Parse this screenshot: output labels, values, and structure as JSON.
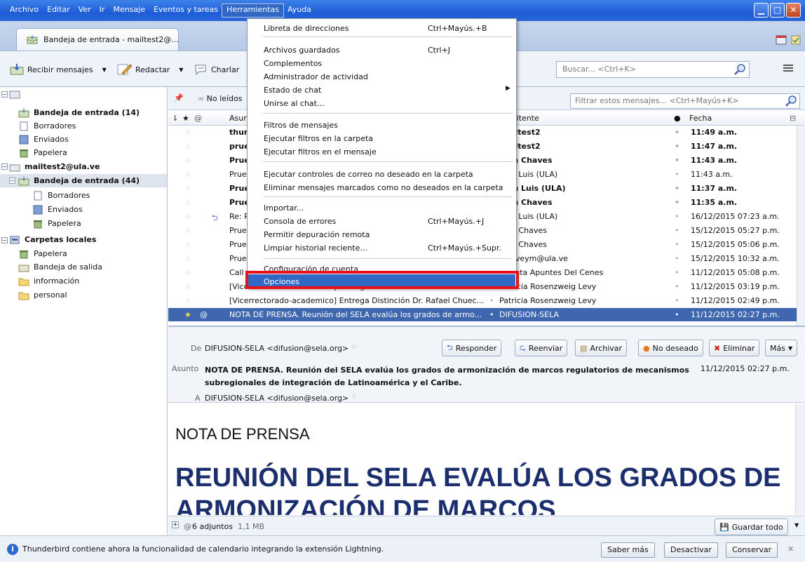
{
  "menubar": {
    "items": [
      "Archivo",
      "Editar",
      "Ver",
      "Ir",
      "Mensaje",
      "Eventos y tareas",
      "Herramientas",
      "Ayuda"
    ]
  },
  "tab": {
    "label": "Bandeja de entrada - mailtest2@..."
  },
  "toolbar": {
    "get_mail": "Recibir mensajes",
    "write": "Redactar",
    "chat": "Charlar",
    "search_placeholder": "Buscar... <Ctrl+K>"
  },
  "folders": [
    {
      "label": "Bandeja de entrada (14)",
      "bold": true,
      "icon": "inbox-icon"
    },
    {
      "label": "Borradores",
      "icon": "drafts-icon"
    },
    {
      "label": "Enviados",
      "icon": "sent-icon"
    },
    {
      "label": "Papelera",
      "icon": "trash-icon"
    },
    {
      "label": "mailtest2@ula.ve",
      "bold": true,
      "icon": "account-icon"
    },
    {
      "label": "Bandeja de entrada (44)",
      "bold": true,
      "icon": "inbox-icon"
    },
    {
      "label": "Borradores",
      "icon": "drafts-icon"
    },
    {
      "label": "Enviados",
      "icon": "sent-icon"
    },
    {
      "label": "Papelera",
      "icon": "trash-icon"
    },
    {
      "label": "Carpetas locales",
      "bold": true,
      "icon": "local-folders-icon"
    },
    {
      "label": "Papelera",
      "icon": "trash-icon"
    },
    {
      "label": "Bandeja de salida",
      "icon": "outbox-icon"
    },
    {
      "label": "información",
      "icon": "folder-icon"
    },
    {
      "label": "personal",
      "icon": "folder-icon"
    }
  ],
  "quickfilter": {
    "unread": "No leídos",
    "filter_placeholder": "Filtrar estos mensajes... <Ctrl+Mayús+K>"
  },
  "columns": {
    "subject": "Asunto",
    "sender": "Remitente",
    "date": "Fecha"
  },
  "messages": [
    {
      "subject": "thunderbird",
      "sender": "mailtest2",
      "date": "11:49 a.m.",
      "bold": true
    },
    {
      "subject": "prueba",
      "sender": "mailtest2",
      "date": "11:47 a.m.",
      "bold": true
    },
    {
      "subject": "Prueba",
      "sender": "Juan Chaves",
      "date": "11:43 a.m.",
      "bold": true
    },
    {
      "subject": "Prueba",
      "sender": "Juan Luis (ULA)",
      "date": "11:43 a.m.",
      "bold": false
    },
    {
      "subject": "Prueba",
      "sender": "Juan Luis (ULA)",
      "date": "11:37 a.m.",
      "bold": true
    },
    {
      "subject": "Prueba",
      "sender": "Juan Chaves",
      "date": "11:35 a.m.",
      "bold": true
    },
    {
      "subject": "Re: Prueba",
      "sender": "Juan Luis (ULA)",
      "date": "16/12/2015 07:23 a.m.",
      "bold": false
    },
    {
      "subject": "Prueba",
      "sender": "Juan Chaves",
      "date": "15/12/2015 05:27 p.m.",
      "bold": false
    },
    {
      "subject": "Prueba",
      "sender": "Juan Chaves",
      "date": "15/12/2015 05:06 p.m.",
      "bold": false
    },
    {
      "subject": "Prueba",
      "sender": "jchaveym@ula.ve",
      "date": "15/12/2015 10:32 a.m.",
      "bold": false
    },
    {
      "subject": "Call for papers",
      "sender": "Revista Apuntes Del Cenes",
      "date": "11/12/2015 05:08 p.m.",
      "bold": false
    },
    {
      "subject": "[Vicerrectorado-academico] Entrega Distinción Dr. Rafael Chuec...",
      "sender": "Patricia Rosenzweig Levy",
      "date": "11/12/2015 03:19 p.m.",
      "bold": false
    },
    {
      "subject": "[Vicerrectorado-academico] Entrega Distinción Dr. Rafael Chuec...",
      "sender": "Patricia Rosenzweig Levy",
      "date": "11/12/2015 02:49 p.m.",
      "bold": false
    },
    {
      "subject": "NOTA DE PRENSA. Reunión del SELA evalúa los grados de armo...",
      "sender": "DIFUSION-SELA",
      "date": "11/12/2015 02:27 p.m.",
      "bold": false
    }
  ],
  "preview": {
    "from_label": "De",
    "from": "DIFUSION-SELA <difusion@sela.org>",
    "subject_label": "Asunto",
    "subject": "NOTA DE PRENSA. Reunión del SELA evalúa los grados de armonización de marcos regulatorios de mecanismos subregionales de integración de Latinoamérica y el Caribe.",
    "date": "11/12/2015 02:27 p.m.",
    "to_label": "A",
    "to": "DIFUSION-SELA <difusion@sela.org>",
    "buttons": {
      "reply": "Responder",
      "forward": "Reenviar",
      "archive": "Archivar",
      "junk": "No deseado",
      "delete": "Eliminar",
      "more": "Más"
    },
    "heading": "NOTA DE PRENSA",
    "headline": "REUNIÓN DEL SELA EVALÚA LOS GRADOS DE ARMONIZACIÓN DE MARCOS",
    "attachments": "6 adjuntos",
    "attachments_size": "1,1 MB",
    "save_all": "Guardar todo"
  },
  "notification": {
    "text": "Thunderbird contiene ahora la funcionalidad de calendario integrando la extensión Lightning.",
    "learn_more": "Saber más",
    "disable": "Desactivar",
    "keep": "Conservar"
  },
  "tools_menu": [
    {
      "label": "Libreta de direcciones",
      "shortcut": "Ctrl+Mayús.+B"
    },
    {
      "label": "Archivos guardados",
      "shortcut": "Ctrl+J"
    },
    {
      "label": "Complementos",
      "shortcut": ""
    },
    {
      "label": "Administrador de actividad",
      "shortcut": ""
    },
    {
      "label": "Estado de chat",
      "shortcut": ""
    },
    {
      "label": "Unirse al chat...",
      "shortcut": ""
    },
    {
      "label": "Filtros de mensajes",
      "shortcut": ""
    },
    {
      "label": "Ejecutar filtros en la carpeta",
      "shortcut": ""
    },
    {
      "label": "Ejecutar filtros en el mensaje",
      "shortcut": ""
    },
    {
      "label": "Ejecutar controles de correo no deseado en la carpeta",
      "shortcut": ""
    },
    {
      "label": "Eliminar mensajes marcados como no deseados en la carpeta",
      "shortcut": ""
    },
    {
      "label": "Importar...",
      "shortcut": ""
    },
    {
      "label": "Consola de errores",
      "shortcut": "Ctrl+Mayús.+J"
    },
    {
      "label": "Permitir depuración remota",
      "shortcut": ""
    },
    {
      "label": "Limpiar historial reciente...",
      "shortcut": "Ctrl+Mayús.+Supr."
    },
    {
      "label": "Configuración de cuenta",
      "shortcut": ""
    },
    {
      "label": "Opciones",
      "shortcut": ""
    }
  ],
  "colors": {
    "titlebar": "#2a66d9",
    "selection": "#3f67b0",
    "menu_highlight": "#3168c6",
    "annotation": "#e8121a",
    "headline": "#1b2f6e"
  }
}
